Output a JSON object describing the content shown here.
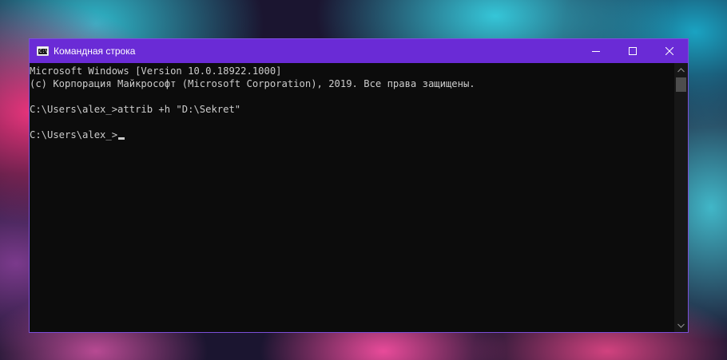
{
  "window": {
    "title": "Командная строка",
    "icon": "cmd-icon",
    "controls": {
      "minimize_icon": "minimize-icon",
      "maximize_icon": "maximize-icon",
      "close_icon": "close-icon"
    }
  },
  "console": {
    "lines": [
      "Microsoft Windows [Version 10.0.18922.1000]",
      "(c) Корпорация Майкрософт (Microsoft Corporation), 2019. Все права защищены.",
      "",
      "C:\\Users\\alex_>attrib +h \"D:\\Sekret\"",
      "",
      "C:\\Users\\alex_>"
    ]
  },
  "colors": {
    "titlebar": "#6a2bd6",
    "console_background": "#0c0c0c",
    "console_text": "#cccccc"
  }
}
